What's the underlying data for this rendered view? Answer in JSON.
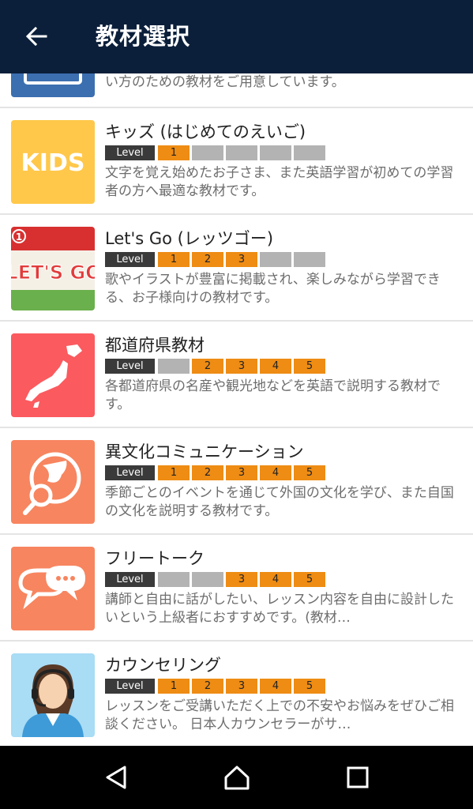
{
  "appbar": {
    "title": "教材選択",
    "back_icon": "arrow-left-icon"
  },
  "level_label": "Level",
  "items": [
    {
      "title": "",
      "levels": [],
      "description": "い方のための教材をご用意しています。",
      "icon": "keyboard-icon",
      "color": "#3b6fb0"
    },
    {
      "title": "キッズ (はじめてのえいご)",
      "levels": [
        {
          "label": "1",
          "on": true
        },
        {
          "label": "",
          "on": false
        },
        {
          "label": "",
          "on": false
        },
        {
          "label": "",
          "on": false
        },
        {
          "label": "",
          "on": false
        }
      ],
      "description": "文字を覚え始めたお子さま、また英語学習が初めての学習者の方へ最適な教材です。",
      "icon": "kids-logo-icon",
      "logo_text": "KIDS",
      "color": "#ffc84a"
    },
    {
      "title": "Let's Go (レッツゴー)",
      "levels": [
        {
          "label": "1",
          "on": true
        },
        {
          "label": "2",
          "on": true
        },
        {
          "label": "3",
          "on": true
        },
        {
          "label": "",
          "on": false
        },
        {
          "label": "",
          "on": false
        }
      ],
      "description": "歌やイラストが豊富に掲載され、楽しみながら学習できる、お子様向けの教材です。",
      "icon": "lets-go-book-icon",
      "logo_text": "LET'S GO",
      "book_number": "1",
      "color": "#e23b3b"
    },
    {
      "title": "都道府県教材",
      "levels": [
        {
          "label": "",
          "on": false
        },
        {
          "label": "2",
          "on": true
        },
        {
          "label": "3",
          "on": true
        },
        {
          "label": "4",
          "on": true
        },
        {
          "label": "5",
          "on": true
        }
      ],
      "description": "各都道府県の名産や観光地などを英語で説明する教材です。",
      "icon": "japan-map-icon",
      "color": "#fb5a5f"
    },
    {
      "title": "異文化コミュニケーション",
      "levels": [
        {
          "label": "1",
          "on": true
        },
        {
          "label": "2",
          "on": true
        },
        {
          "label": "3",
          "on": true
        },
        {
          "label": "4",
          "on": true
        },
        {
          "label": "5",
          "on": true
        }
      ],
      "description": "季節ごとのイベントを通じて外国の文化を学び、また自国の文化を説明する教材です。",
      "icon": "globe-search-icon",
      "color": "#f7855f"
    },
    {
      "title": "フリートーク",
      "levels": [
        {
          "label": "",
          "on": false
        },
        {
          "label": "",
          "on": false
        },
        {
          "label": "3",
          "on": true
        },
        {
          "label": "4",
          "on": true
        },
        {
          "label": "5",
          "on": true
        }
      ],
      "description": "講師と自由に話がしたい、レッスン内容を自由に設計したいという上級者におすすめです。(教材…",
      "icon": "chat-bubbles-icon",
      "color": "#f7855f"
    },
    {
      "title": "カウンセリング",
      "levels": [
        {
          "label": "1",
          "on": true
        },
        {
          "label": "2",
          "on": true
        },
        {
          "label": "3",
          "on": true
        },
        {
          "label": "4",
          "on": true
        },
        {
          "label": "5",
          "on": true
        }
      ],
      "description": "レッスンをご受講いただく上での不安やお悩みをぜひご相談ください。 日本人カウンセラーがサ…",
      "icon": "counselor-headset-icon",
      "color": "#a9dcf5"
    }
  ],
  "navbar": {
    "back_icon": "triangle-back-icon",
    "home_icon": "home-icon",
    "recents_icon": "square-recents-icon"
  }
}
